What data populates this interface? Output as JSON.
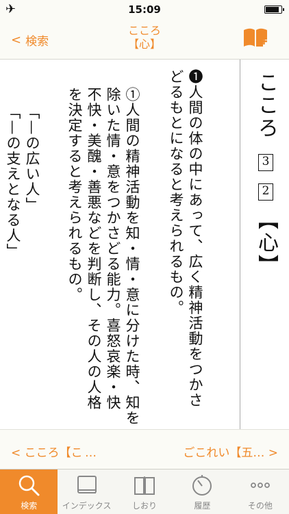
{
  "status_bar": {
    "time": "15:09",
    "airplane_icon": "airplane-icon",
    "battery_icon": "battery-icon"
  },
  "nav": {
    "back_label": "検索",
    "title_line1": "こころ",
    "title_line2": "【心】",
    "bookmark_icon": "book-add-icon"
  },
  "entry": {
    "headword": "こころ",
    "badges": [
      "3",
      "2"
    ],
    "kanji": "【心】",
    "columns": [
      "❶人間の体の中にあって、広く精神活動をつかさ",
      "どるもとになると考えられるもの。",
      "①人間の精神活動を知・情・意に分けた時、知を",
      "除いた情・意をつかさどる能力。喜怒哀楽・快",
      "不快・美醜・善悪などを判断し、その人の人格",
      "を決定すると考えられるもの。",
      "「—の広い人」",
      "「—の支えとなる人」"
    ]
  },
  "pager": {
    "prev_label": "こころ【こ …",
    "next_label": "ごこれい【五…"
  },
  "tabs": [
    {
      "label": "検索",
      "icon": "search-icon",
      "active": true
    },
    {
      "label": "インデックス",
      "icon": "book-icon",
      "active": false
    },
    {
      "label": "しおり",
      "icon": "open-book-icon",
      "active": false
    },
    {
      "label": "履歴",
      "icon": "history-clock-icon",
      "active": false
    },
    {
      "label": "その他",
      "icon": "more-icon",
      "active": false
    }
  ],
  "colors": {
    "accent": "#f08a2b",
    "bar_bg": "#fbfbf6"
  }
}
